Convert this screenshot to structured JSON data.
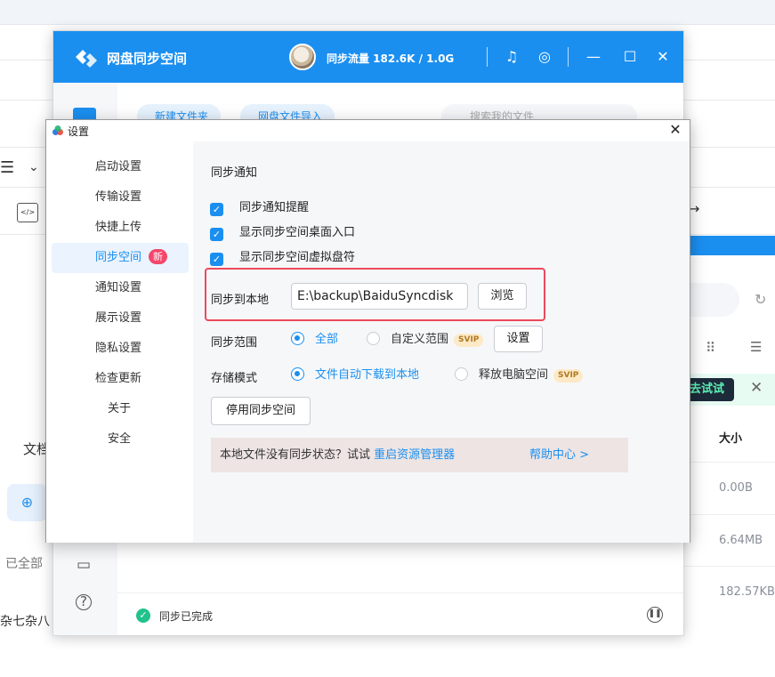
{
  "background_window": {
    "left_texts": [
      "文档",
      "已全部",
      "杂七杂八"
    ],
    "right_header_tryit": "去试试",
    "size_header": "大小",
    "sizes": [
      "0.00B",
      "6.64MB",
      "182.57KB"
    ]
  },
  "sync_window": {
    "title": "网盘同步空间",
    "traffic": "同步流量 182.6K / 1.0G",
    "toolbar": {
      "new_folder": "新建文件夹",
      "import": "网盘文件导入",
      "search_placeholder": "搜索我的文件"
    },
    "status": "同步已完成"
  },
  "dialog": {
    "title": "设置",
    "nav": [
      {
        "label": "启动设置"
      },
      {
        "label": "传输设置"
      },
      {
        "label": "快捷上传"
      },
      {
        "label": "同步空间",
        "badge": "新",
        "active": true
      },
      {
        "label": "通知设置"
      },
      {
        "label": "展示设置"
      },
      {
        "label": "隐私设置"
      },
      {
        "label": "检查更新"
      },
      {
        "label": "关于"
      },
      {
        "label": "安全"
      }
    ],
    "section_title": "同步通知",
    "checkboxes": [
      "同步通知提醒",
      "显示同步空间桌面入口",
      "显示同步空间虚拟盘符"
    ],
    "sync_local_label": "同步到本地",
    "sync_local_path": "E:\\backup\\BaiduSyncdisk",
    "browse_button": "浏览",
    "sync_range_label": "同步范围",
    "range_all": "全部",
    "range_custom": "自定义范围",
    "svip": "SVIP",
    "range_settings_button": "设置",
    "storage_mode_label": "存储模式",
    "mode_auto_download": "文件自动下载到本地",
    "mode_free_space": "释放电脑空间",
    "disable_button": "停用同步空间",
    "tip_text": "本地文件没有同步状态？试试",
    "tip_link": "重启资源管理器",
    "help_link": "帮助中心 >"
  },
  "colors": {
    "accent": "#1b8ff0",
    "highlight": "#ec4a5c",
    "badge_new": "#f4476b",
    "success": "#20c38a"
  }
}
